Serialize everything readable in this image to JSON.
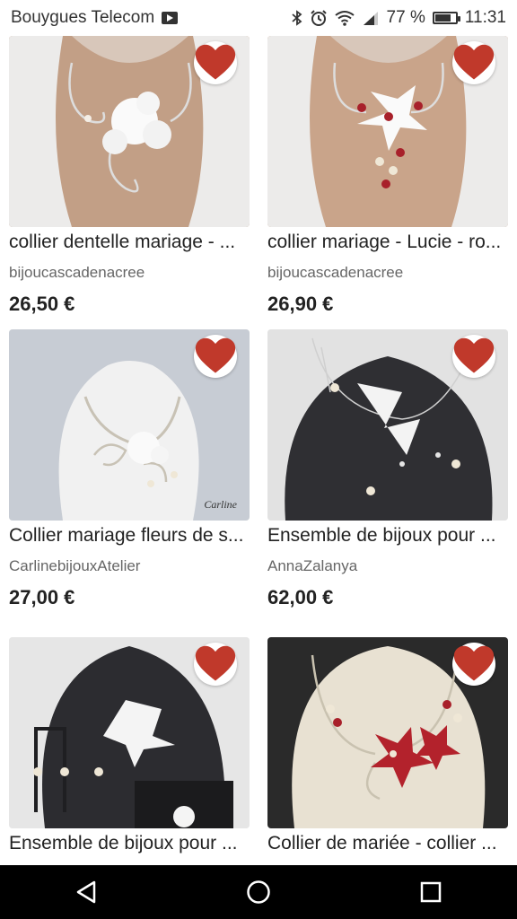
{
  "status": {
    "carrier": "Bouygues Telecom",
    "battery_percent": "77 %",
    "battery_level": 0.77,
    "time": "11:31"
  },
  "products": [
    {
      "title": "collier dentelle mariage - ...",
      "shop": "bijoucascadenacree",
      "price": "26,50 €",
      "favorited": true
    },
    {
      "title": "collier mariage - Lucie - ro...",
      "shop": "bijoucascadenacree",
      "price": "26,90 €",
      "favorited": true
    },
    {
      "title": "Collier mariage fleurs de s...",
      "shop": "CarlinebijouxAtelier",
      "price": "27,00 €",
      "favorited": true,
      "watermark": "Carline"
    },
    {
      "title": "Ensemble de bijoux pour ...",
      "shop": "AnnaZalanya",
      "price": "62,00 €",
      "favorited": true
    },
    {
      "title": "Ensemble de bijoux pour ...",
      "shop": "",
      "price": "",
      "favorited": true
    },
    {
      "title": "Collier de mariée - collier ...",
      "shop": "",
      "price": "",
      "favorited": true
    }
  ],
  "colors": {
    "favorite_heart": "#c0392b",
    "nav_bar": "#000000"
  }
}
